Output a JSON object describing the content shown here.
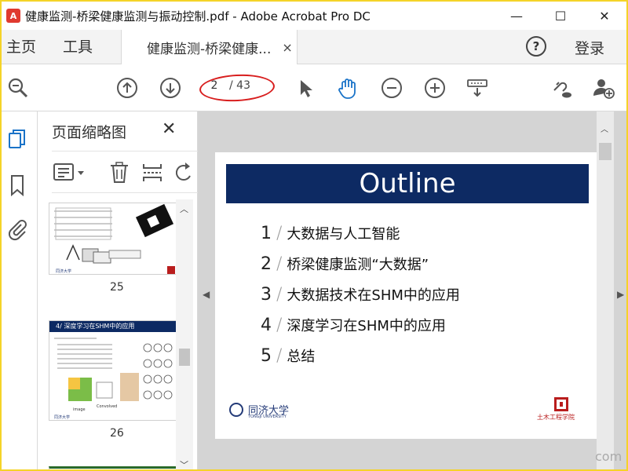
{
  "window": {
    "title": "健康监测-桥梁健康监测与振动控制.pdf - Adobe Acrobat Pro DC",
    "controls": {
      "minimize": "—",
      "maximize": "☐",
      "close": "✕"
    }
  },
  "tabs": {
    "home": "主页",
    "tools": "工具",
    "document": "健康监测-桥梁健康...",
    "document_close": "×",
    "help": "?",
    "login": "登录"
  },
  "toolbar": {
    "current_page": "2",
    "total_pages": "/ 43",
    "icons": [
      "zoom-search-icon",
      "page-up-icon",
      "page-down-icon",
      "select-pointer-icon",
      "hand-tool-icon",
      "zoom-out-icon",
      "zoom-in-icon",
      "fit-page-icon",
      "link-cloud-icon",
      "add-user-icon"
    ]
  },
  "panel": {
    "title": "页面缩略图",
    "close": "✕",
    "thumbnails": [
      {
        "page": "25"
      },
      {
        "page": "26",
        "heading": "4/ 深度学习在SHM中的应用"
      }
    ]
  },
  "slide": {
    "title": "Outline",
    "items": [
      {
        "num": "1",
        "text": "大数据与人工智能"
      },
      {
        "num": "2",
        "text": "桥梁健康监测“大数据”"
      },
      {
        "num": "3",
        "text": "大数据技术在SHM中的应用"
      },
      {
        "num": "4",
        "text": "深度学习在SHM中的应用"
      },
      {
        "num": "5",
        "text": "总结"
      }
    ],
    "logo_left": "同济大学",
    "logo_left_sub": "TONGJI UNIVERSITY",
    "logo_right": "土木工程学院"
  },
  "colors": {
    "slide_header": "#0d2a63",
    "annotation_oval": "#d81e1e",
    "hand_tool_active": "#1a73c8"
  },
  "watermark": "com"
}
